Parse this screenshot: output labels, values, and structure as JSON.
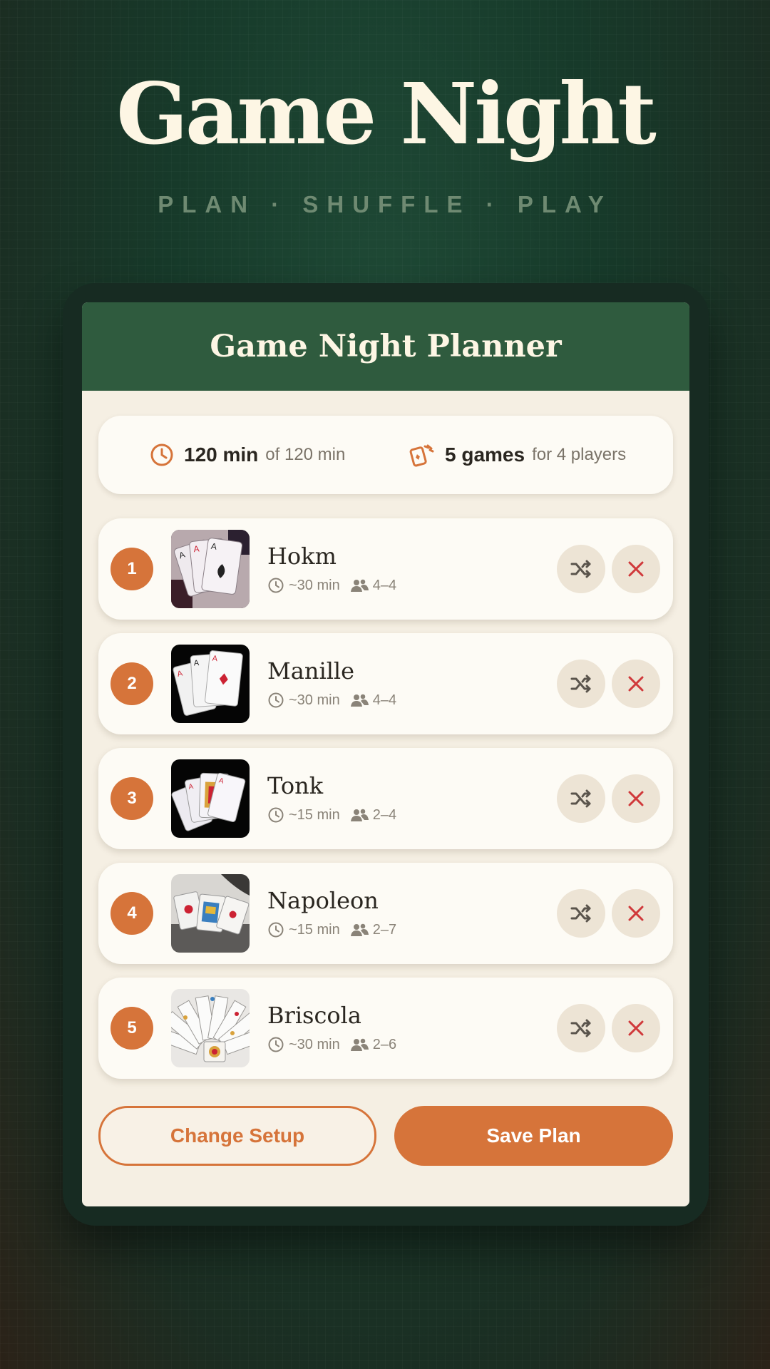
{
  "hero": {
    "title": "Game Night",
    "subtitle": "PLAN · SHUFFLE · PLAY"
  },
  "planner": {
    "title": "Game Night Planner",
    "summary": {
      "time_icon": "clock-icon",
      "time_value": "120 min",
      "time_of": "of 120 min",
      "games_icon": "cards-icon",
      "games_value": "5 games",
      "games_for": "for 4 players"
    },
    "games": [
      {
        "rank": "1",
        "name": "Hokm",
        "time": "~30 min",
        "players": "4–4",
        "image": "spread-of-aces-photo"
      },
      {
        "rank": "2",
        "name": "Manille",
        "time": "~30 min",
        "players": "4–4",
        "image": "aces-on-black-photo"
      },
      {
        "rank": "3",
        "name": "Tonk",
        "time": "~15 min",
        "players": "2–4",
        "image": "hand-of-cards-on-black-photo"
      },
      {
        "rank": "4",
        "name": "Napoleon",
        "time": "~15 min",
        "players": "2–7",
        "image": "scattered-cards-photo"
      },
      {
        "rank": "5",
        "name": "Briscola",
        "time": "~30 min",
        "players": "2–6",
        "image": "fanned-italian-cards-photo"
      }
    ],
    "actions": {
      "change_setup": "Change Setup",
      "save_plan": "Save Plan"
    }
  },
  "colors": {
    "background": "#173a2a",
    "header": "#2f5b3e",
    "card": "#f5efe3",
    "accent": "#d6743a",
    "remove": "#d0393b"
  }
}
